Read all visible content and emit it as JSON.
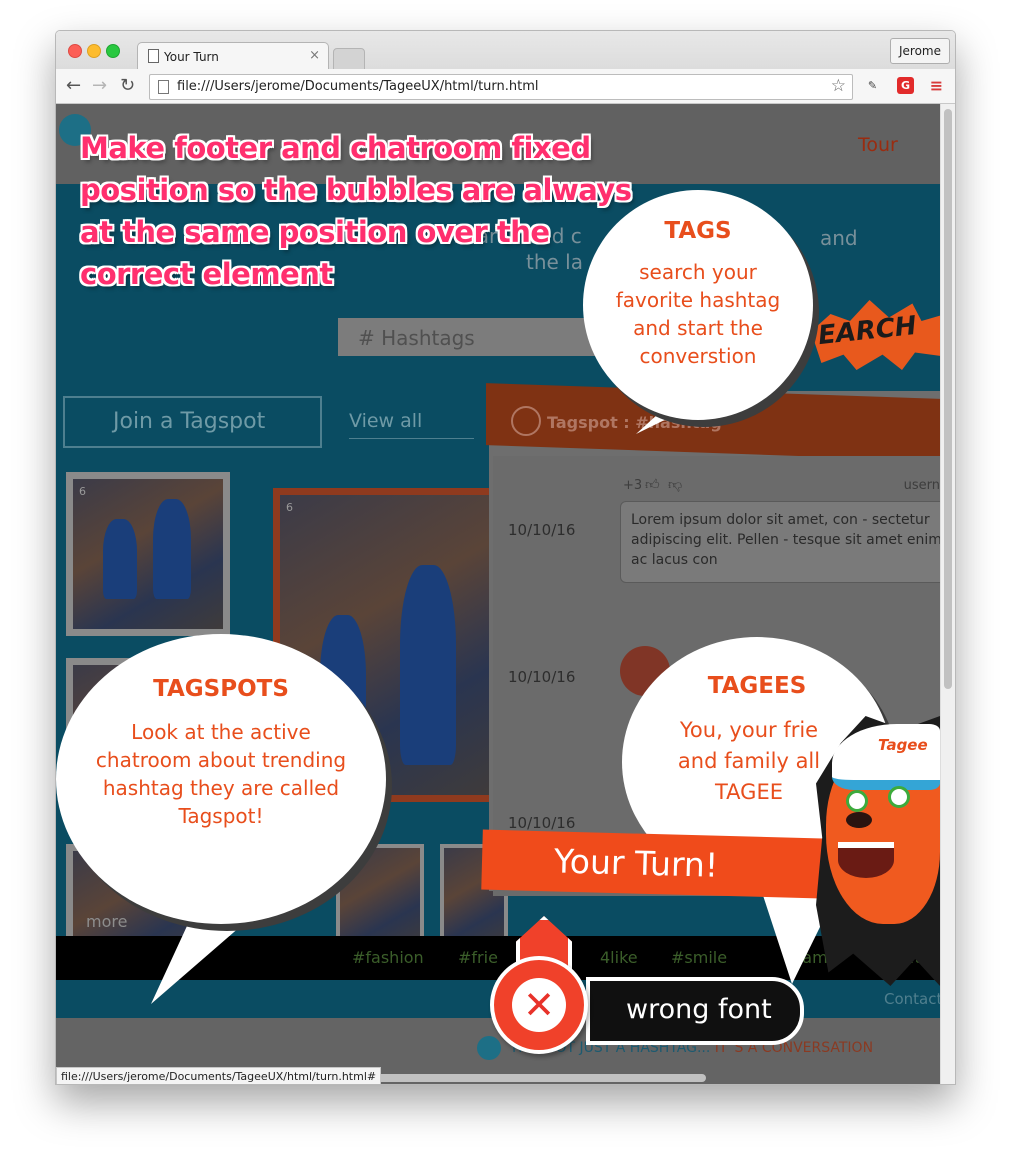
{
  "browser": {
    "tab_title": "Your Turn",
    "tab_close": "×",
    "profile_name": "Jerome",
    "url": "file:///Users/jerome/Documents/TageeUX/html/turn.html",
    "status_url": "file:///Users/jerome/Documents/TageeUX/html/turn.html#",
    "extension_g_label": "G"
  },
  "page": {
    "nav_tour": "Tour",
    "hero_line1": "search and c",
    "hero_line2": "the la",
    "hero_and": "and",
    "search_placeholder": "# Hashtags",
    "search_burst": "EARCH",
    "join_button": "Join a Tagspot",
    "view_all": "View all",
    "photo_count": "6",
    "more_link": "more",
    "chat": {
      "title": "Tagspot : #hashtag",
      "meta": "+3",
      "user": "usern",
      "dates": [
        "10/10/16",
        "10/10/16",
        "10/10/16"
      ],
      "message": "Lorem ipsum dolor sit amet, con - sectetur adipiscing elit. Pellen - tesque sit amet enim ac lacus con"
    },
    "hashtags": [
      "#fashion",
      "#frie",
      "4like",
      "#smile",
      "tamo",
      "#fam"
    ],
    "contact": "Contact",
    "tagline_a": "IT´S NOT JUST A HASHTAG...",
    "tagline_b": "IT´S A CONVERSATION"
  },
  "annotation": {
    "text": "Make  footer and chatroom fixed position so the bubbles are always at the same position over the correct element",
    "color": "#ff2f6e"
  },
  "bubbles": {
    "tags": {
      "title": "TAGS",
      "text": "search your favorite hashtag and start the converstion"
    },
    "tagspots": {
      "title": "TAGSPOTS",
      "text": "Look at the active chatroom about trending hashtag they are called Tagspot!"
    },
    "tagees": {
      "title": "TAGEES",
      "text": "You, your frie and family all TAGEE"
    }
  },
  "your_turn": "Your Turn!",
  "wrong_font": "wrong font",
  "mascot_logo": "Tagee",
  "colors": {
    "accent_orange": "#e84e1c",
    "brand_blue": "#0a4c62"
  }
}
